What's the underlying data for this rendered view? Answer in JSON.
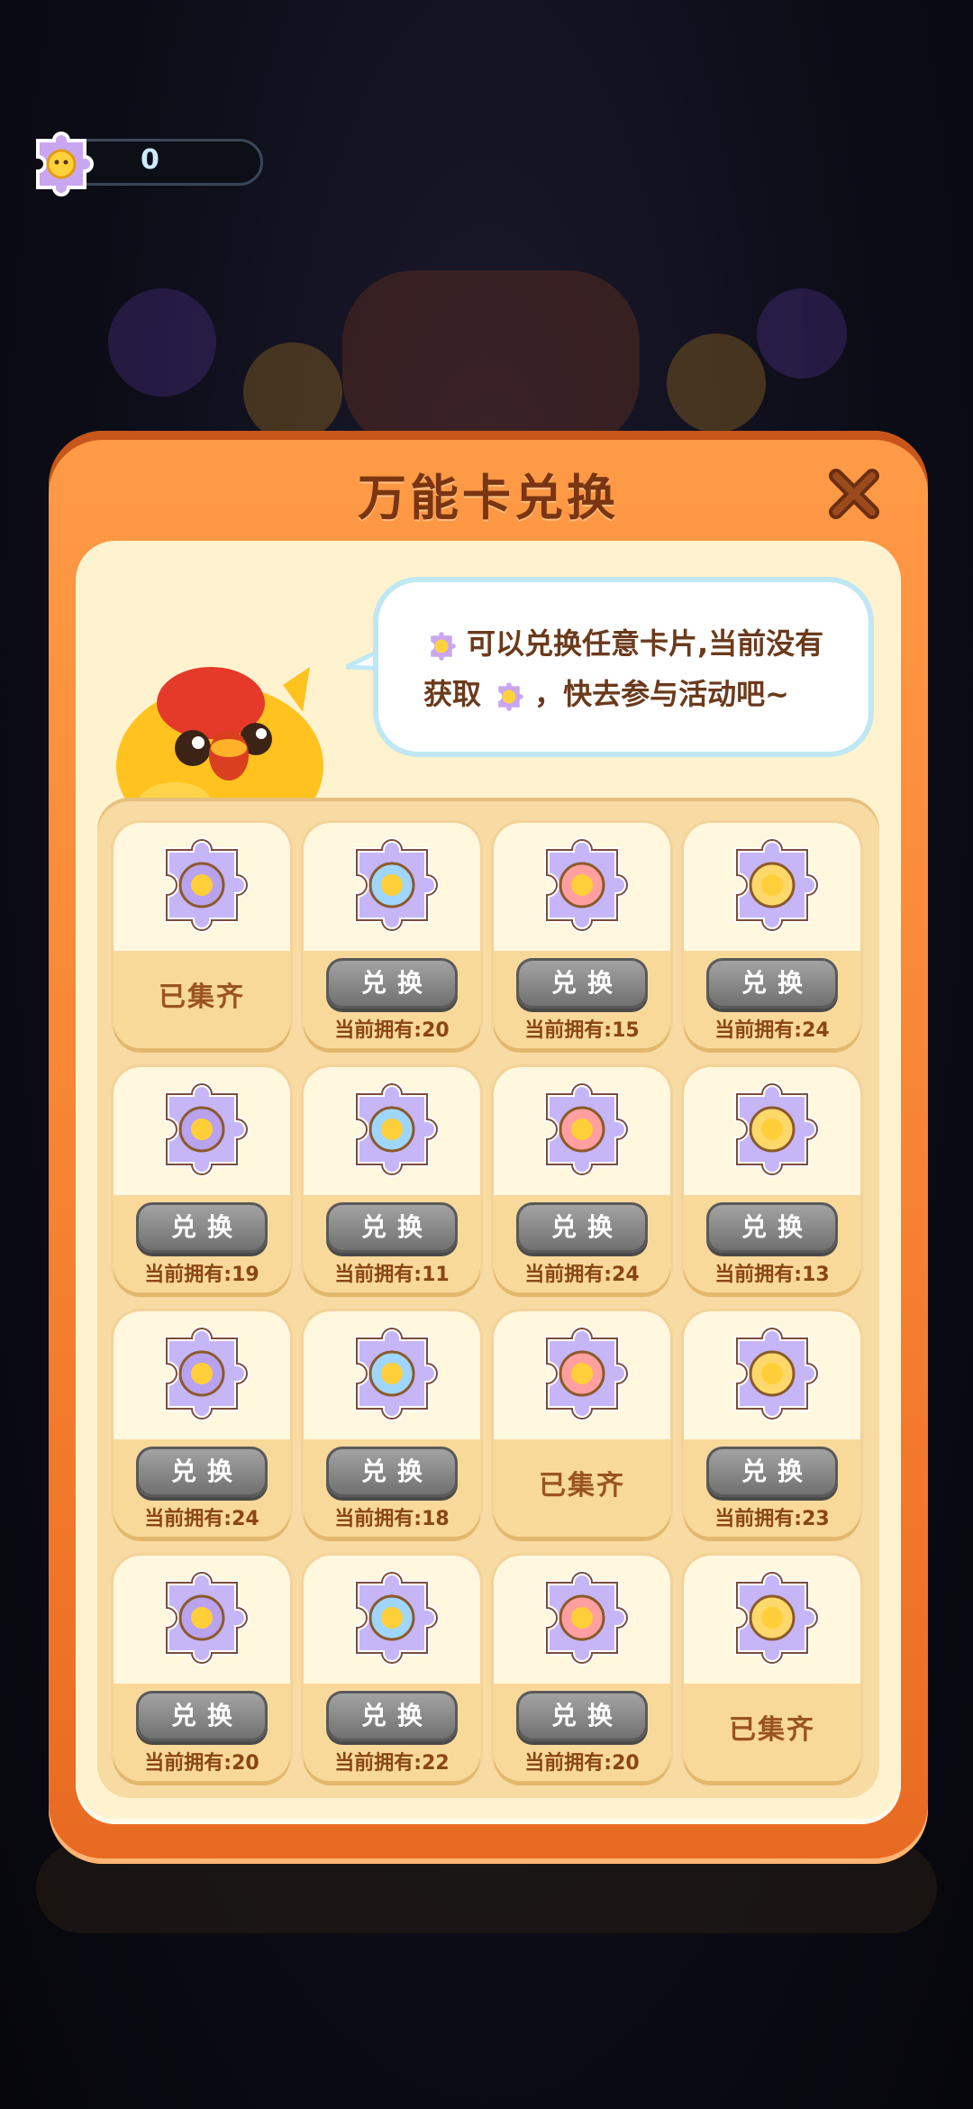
{
  "counter": {
    "value": "0",
    "icon": "gold-card-icon"
  },
  "modal": {
    "title": "万能卡兑换",
    "close_icon": "close-icon",
    "bubble": {
      "line1": "可以兑换任意卡片,当前没有",
      "line2_prefix": "获取",
      "line2_suffix": "，快去参与活动吧~"
    }
  },
  "cards": [
    {
      "icon": "chicken-stage-card-icon",
      "status": "collected",
      "status_text": "已集齐"
    },
    {
      "icon": "wreath-card-icon",
      "button": "兑换",
      "owned": "当前拥有:20"
    },
    {
      "icon": "tea-table-card-icon",
      "button": "兑换",
      "owned": "当前拥有:15"
    },
    {
      "icon": "cow-frame-card-icon",
      "button": "兑换",
      "owned": "当前拥有:24"
    },
    {
      "icon": "heart-arch-card-icon",
      "button": "兑换",
      "owned": "当前拥有:19"
    },
    {
      "icon": "flower-wreath-card-icon",
      "button": "兑换",
      "owned": "当前拥有:11"
    },
    {
      "icon": "pagoda-card-icon",
      "button": "兑换",
      "owned": "当前拥有:24"
    },
    {
      "icon": "flower-knot-card-icon",
      "button": "兑换",
      "owned": "当前拥有:13"
    },
    {
      "icon": "fox-cat-card-icon",
      "button": "兑换",
      "owned": "当前拥有:24"
    },
    {
      "icon": "chicken-sprout-card-icon",
      "button": "兑换",
      "owned": "当前拥有:18"
    },
    {
      "icon": "pink-fish-card-icon",
      "status": "collected",
      "status_text": "已集齐"
    },
    {
      "icon": "red-hat-hero-card-icon",
      "button": "兑换",
      "owned": "当前拥有:23"
    },
    {
      "icon": "blue-knight-card-icon",
      "button": "兑换",
      "owned": "当前拥有:20"
    },
    {
      "icon": "bear-chef-card-icon",
      "button": "兑换",
      "owned": "当前拥有:22"
    },
    {
      "icon": "hi-sign-card-icon",
      "button": "兑换",
      "owned": "当前拥有:20"
    },
    {
      "icon": "hi-sign-pink-card-icon",
      "status": "collected",
      "status_text": "已集齐"
    }
  ],
  "colors": {
    "modal_orange": "#f37a2d",
    "panel_cream": "#fff3cf",
    "button_gray": "#8a8a8a"
  }
}
